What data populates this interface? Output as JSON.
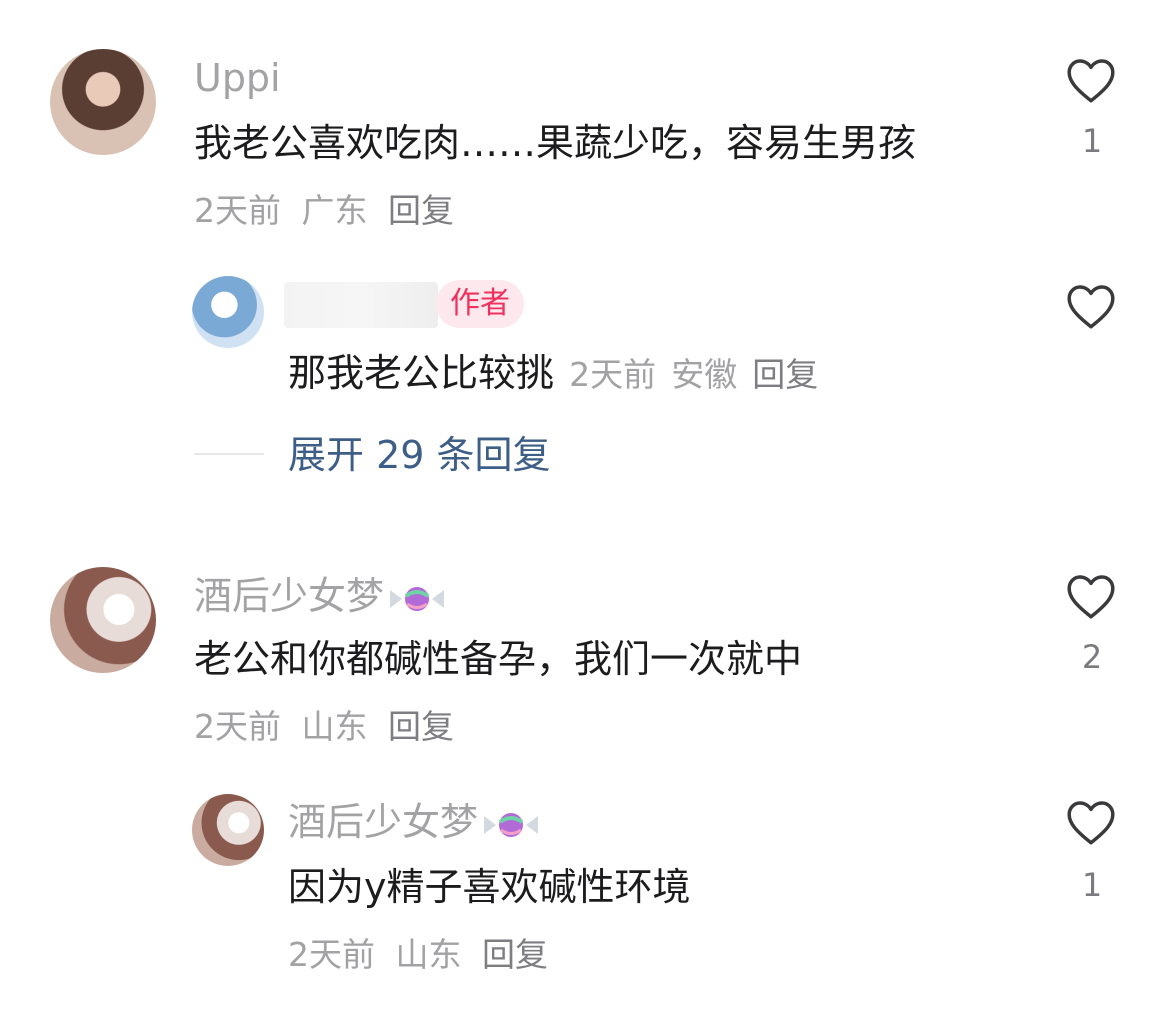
{
  "comments": [
    {
      "username": "Uppi",
      "text": "我老公喜欢吃肉……果蔬少吃，容易生男孩",
      "time": "2天前",
      "location": "广东",
      "reply_label": "回复",
      "likes": "1",
      "reply": {
        "author_badge": "作者",
        "text": "那我老公比较挑",
        "time": "2天前",
        "location": "安徽",
        "reply_label": "回复"
      },
      "expand_label": "展开 29 条回复"
    },
    {
      "username": "酒后少女梦",
      "text": "老公和你都碱性备孕，我们一次就中",
      "time": "2天前",
      "location": "山东",
      "reply_label": "回复",
      "likes": "2",
      "reply": {
        "username": "酒后少女梦",
        "text": "因为y精子喜欢碱性环境",
        "time": "2天前",
        "location": "山东",
        "reply_label": "回复",
        "likes": "1"
      }
    }
  ],
  "icons": {
    "like": "heart-outline-icon",
    "candy": "candy-emoji-icon"
  },
  "colors": {
    "accent_link": "#3d5e86",
    "author_badge_bg": "#fde8ee",
    "author_badge_text": "#f0315d",
    "secondary_text": "#a2a2a5"
  }
}
